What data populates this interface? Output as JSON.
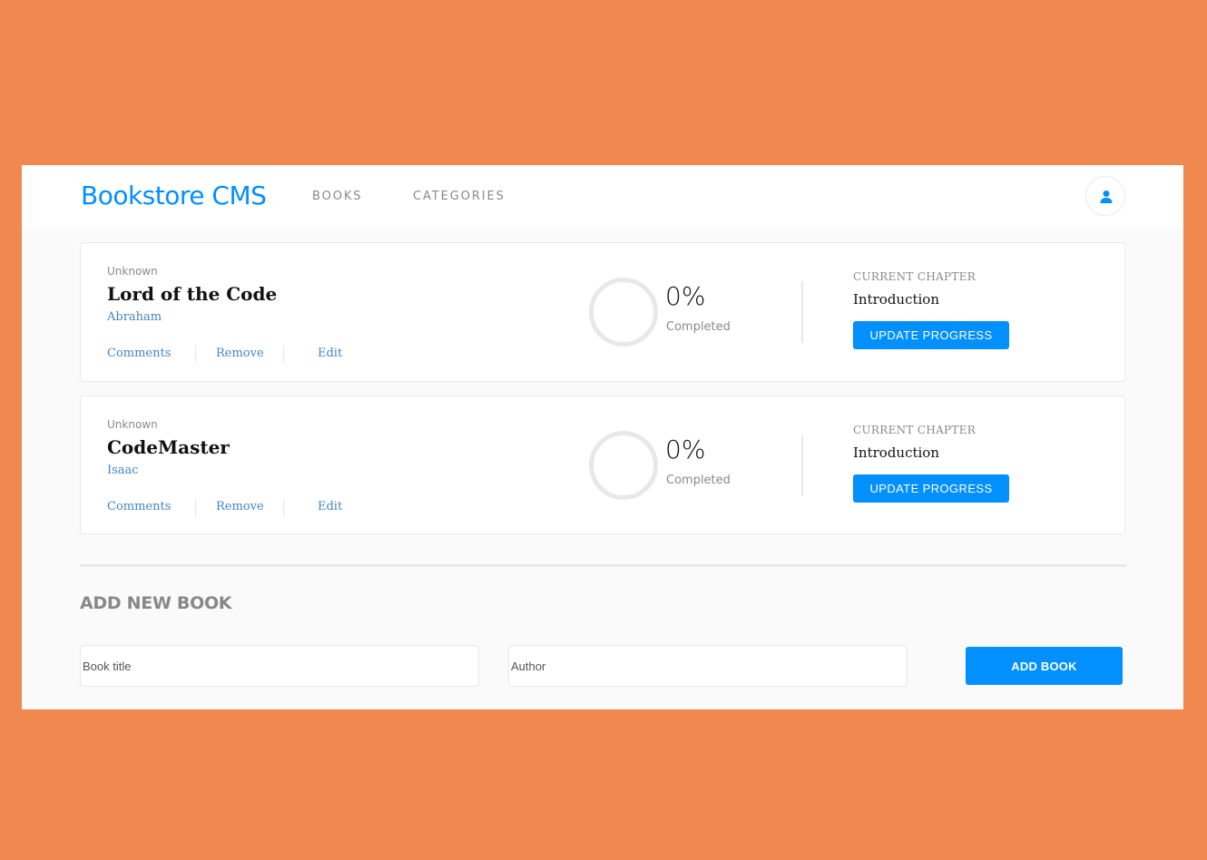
{
  "header": {
    "brand": "Bookstore CMS",
    "nav": [
      "BOOKS",
      "CATEGORIES"
    ],
    "user_icon": "user-icon"
  },
  "books": [
    {
      "genre": "Unknown",
      "title": "Lord of the Code",
      "author": "Abraham",
      "actions": [
        "Comments",
        "Remove",
        "Edit"
      ],
      "progress_percent": "0%",
      "progress_label": "Completed",
      "progress_value": 0,
      "chapter_label": "CURRENT CHAPTER",
      "chapter": "Introduction",
      "update_button": "UPDATE PROGRESS"
    },
    {
      "genre": "Unknown",
      "title": "CodeMaster",
      "author": "Isaac",
      "actions": [
        "Comments",
        "Remove",
        "Edit"
      ],
      "progress_percent": "0%",
      "progress_label": "Completed",
      "progress_value": 0,
      "chapter_label": "CURRENT CHAPTER",
      "chapter": "Introduction",
      "update_button": "UPDATE PROGRESS"
    }
  ],
  "form": {
    "heading": "ADD NEW BOOK",
    "title_placeholder": "Book title",
    "author_placeholder": "Author",
    "submit_label": "ADD BOOK"
  },
  "colors": {
    "page_background": "#f08850",
    "accent": "#0290ff",
    "link": "#4386bf"
  }
}
